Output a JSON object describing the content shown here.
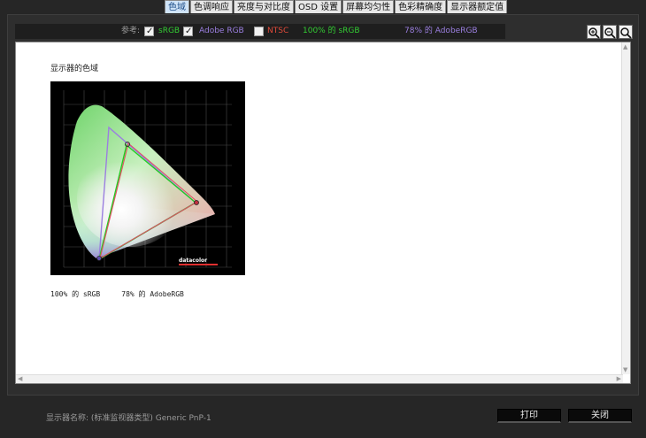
{
  "tabs": [
    {
      "label": "色域",
      "active": true
    },
    {
      "label": "色调响应",
      "active": false
    },
    {
      "label": "亮度与对比度",
      "active": false
    },
    {
      "label": "OSD 设置",
      "active": false
    },
    {
      "label": "屏幕均匀性",
      "active": false
    },
    {
      "label": "色彩精确度",
      "active": false
    },
    {
      "label": "显示器额定值",
      "active": false
    }
  ],
  "toolbar": {
    "reference_label": "参考:",
    "srgb": {
      "label": "sRGB",
      "checked": true,
      "color": "#33cc33"
    },
    "adobergb": {
      "label": "Adobe RGB",
      "checked": true,
      "color": "#9b7fe0"
    },
    "ntsc": {
      "label": "NTSC",
      "checked": false,
      "color": "#e04a3a"
    },
    "srgb_coverage": "100% 的 sRGB",
    "adobergb_coverage": "78% 的 AdobeRGB"
  },
  "zoom": {
    "icons": [
      "zoom-in-icon",
      "zoom-out-icon",
      "zoom-fit-icon"
    ]
  },
  "content": {
    "section_title": "显示器的色域",
    "chart_brand": "datacolor",
    "summary_srgb": "100% 的 sRGB",
    "summary_adobergb": "78% 的 AdobeRGB"
  },
  "footer": {
    "monitor_label": "显示器名称: (标准监视器类型) Generic PnP-1",
    "print_label": "打印",
    "close_label": "关闭"
  },
  "colors": {
    "window_bg": "#262626",
    "content_bg": "#ffffff",
    "srgb_line": "#22cc22",
    "adobe_line": "#9b7fe0",
    "measured_line": "#e05060"
  }
}
